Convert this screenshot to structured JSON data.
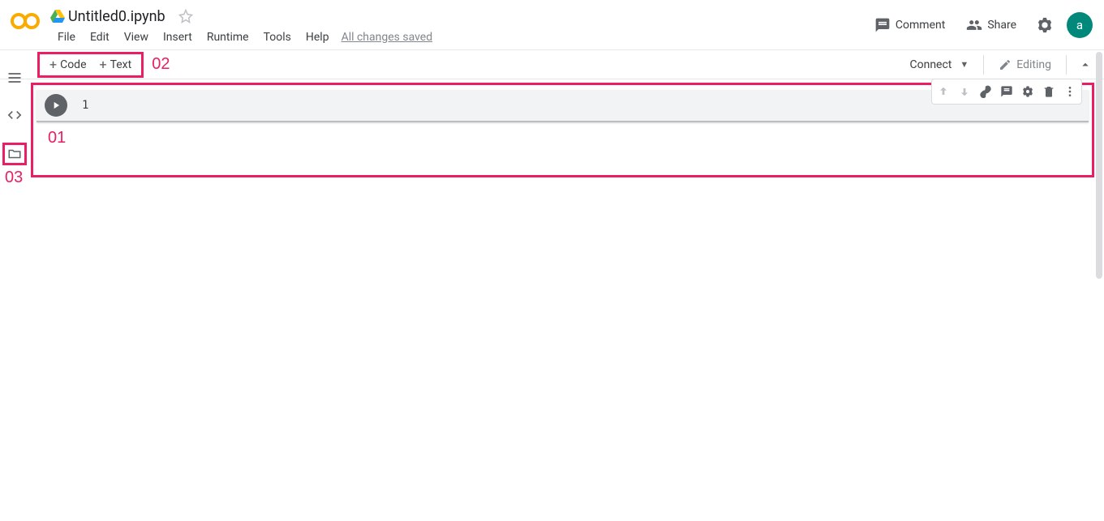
{
  "header": {
    "filename": "Untitled0.ipynb",
    "menu": [
      "File",
      "Edit",
      "View",
      "Insert",
      "Runtime",
      "Tools",
      "Help"
    ],
    "saved": "All changes saved",
    "comment": "Comment",
    "share": "Share",
    "avatar": "a"
  },
  "toolbar": {
    "code": "Code",
    "text": "Text",
    "connect": "Connect",
    "editing": "Editing"
  },
  "annotations": {
    "a01": "01",
    "a02": "02",
    "a03": "03"
  },
  "cell": {
    "line_no": "1"
  }
}
